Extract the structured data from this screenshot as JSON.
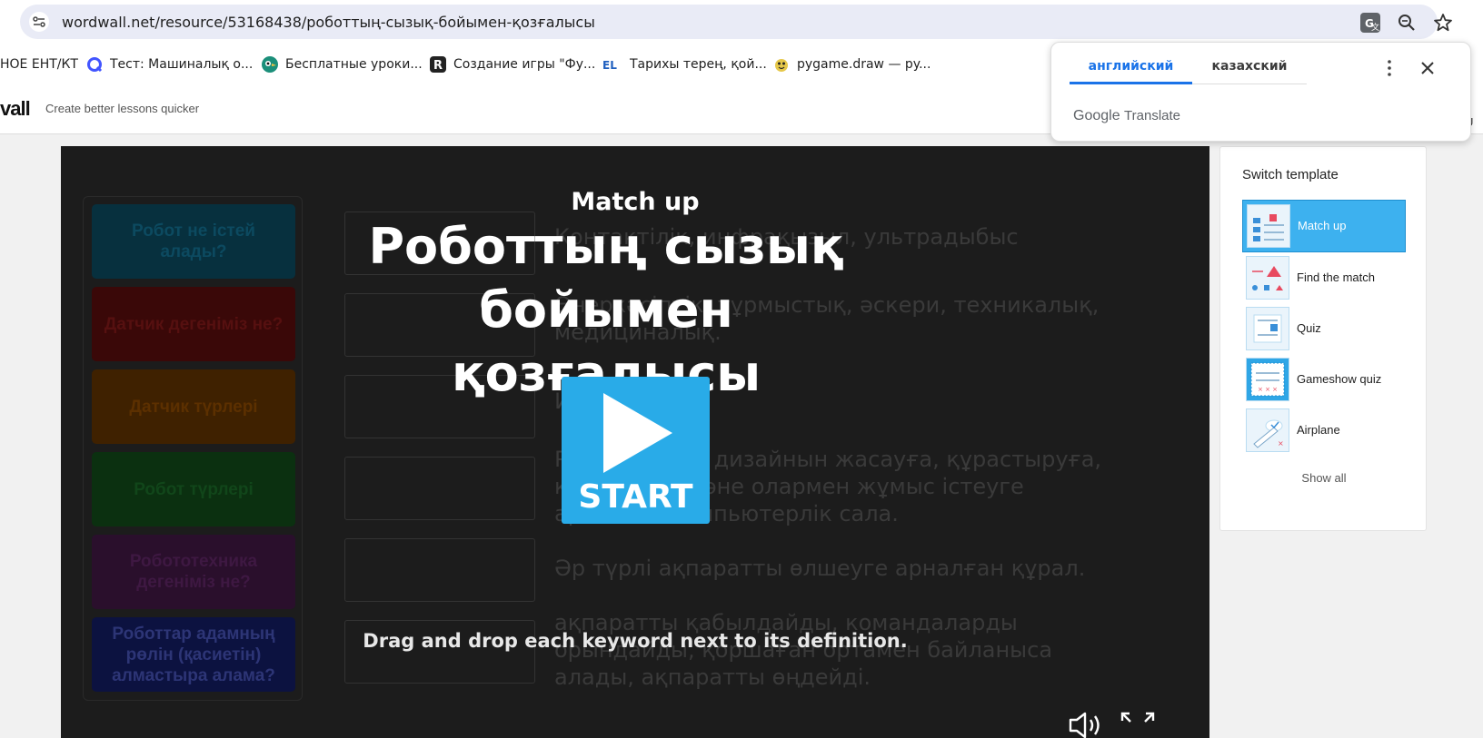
{
  "browser": {
    "url": "wordwall.net/resource/53168438/роботтың-сызық-бойымен-қозғалысы"
  },
  "bookmarks": [
    {
      "label": "НОЕ ЕНТ/КТ",
      "icon": "none"
    },
    {
      "label": "Тест: Машиналық о...",
      "icon": "quizlet-q-icon",
      "color": "#4255ff"
    },
    {
      "label": "Бесплатные уроки...",
      "icon": "bird-icon",
      "color": "#1b8f7a"
    },
    {
      "label": "Создание игры \"Фу...",
      "icon": "r-logo-icon",
      "color": "#222222"
    },
    {
      "label": "Тарихы терең, қой...",
      "icon": "el-logo-icon",
      "color": "#1f5fbf"
    },
    {
      "label": "pygame.draw — py...",
      "icon": "pygame-icon",
      "color": "#e6c84a"
    }
  ],
  "site": {
    "logo_fragment": "vall",
    "tagline": "Create better lessons quicker",
    "edge_text": "n U"
  },
  "game": {
    "overlay_small_title": "Match up",
    "overlay_title": "Роботтың сызық бойымен қозғалысы",
    "start_label": "START",
    "instruction": "Drag and drop each keyword next to its definition.",
    "keywords": [
      {
        "label": "Робот не істей алады?",
        "color": "#07303e",
        "text_color": "#0c4a60"
      },
      {
        "label": "Датчик дегеніміз не?",
        "color": "#3a0808",
        "text_color": "#561010"
      },
      {
        "label": "Датчик түрлері",
        "color": "#3f2100",
        "text_color": "#5c3000"
      },
      {
        "label": "Робот түрлері",
        "color": "#0b3010",
        "text_color": "#11461a"
      },
      {
        "label": "Робототехника дегеніміз не?",
        "color": "#2a0f2c",
        "text_color": "#3e1842"
      },
      {
        "label": "Роботтар адамның рөлін (қасиетін) алмастыра алама?",
        "color": "#0c1240",
        "text_color": "#2d3576"
      }
    ],
    "definitions": [
      "Контактілік, инфрақызыл, ультрадыбыс",
      "Өнеркәсіптік, тұрмыстық, әскери, техникалық, медициналық.",
      "Иә",
      "Роботтардың дизайнын жасауға, құрастыруға, қолдануға және олармен жұмыс істеуге арналған компьютерлік сала.",
      "Әр түрлі ақпаратты өлшеуге арналған құрал.",
      "ақпаратты қабылдайды, командаларды орындайды, қоршаған ортамен байланыса алады, ақпаратты өңдейді."
    ],
    "controls": [
      {
        "name": "volume-icon"
      },
      {
        "name": "fullscreen-icon"
      }
    ]
  },
  "templates": {
    "title": "Switch template",
    "items": [
      {
        "label": "Match up",
        "active": true
      },
      {
        "label": "Find the match",
        "active": false
      },
      {
        "label": "Quiz",
        "active": false
      },
      {
        "label": "Gameshow quiz",
        "active": false
      },
      {
        "label": "Airplane",
        "active": false
      }
    ],
    "show_all": "Show all"
  },
  "translate": {
    "tabs": [
      {
        "label": "английский",
        "active": true
      },
      {
        "label": "казахский",
        "active": false
      }
    ],
    "brand_google": "Google",
    "brand_translate": "Translate"
  },
  "colors": {
    "accent": "#29abe8",
    "template_active": "#3db1ef",
    "translate_accent": "#1a73e8"
  }
}
